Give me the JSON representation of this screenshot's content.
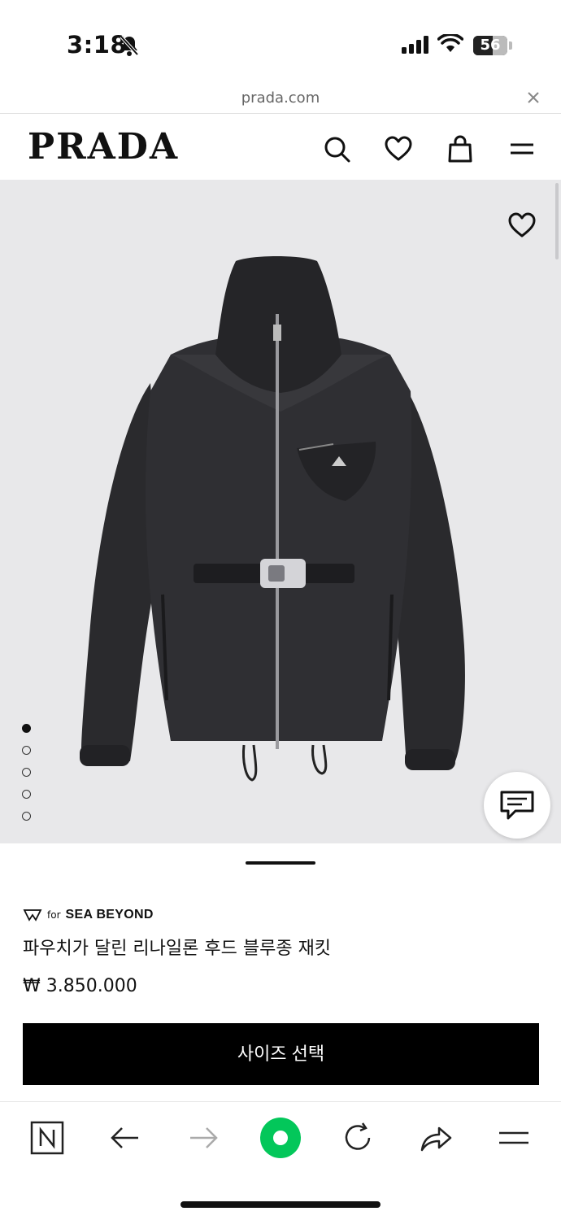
{
  "status_bar": {
    "time": "3:18",
    "battery": "56",
    "battery_level": 0.56,
    "icons": [
      "bell-slash-icon",
      "signal-icon",
      "wifi-icon",
      "battery-icon"
    ]
  },
  "browser": {
    "url": "prada.com",
    "close_icon": "close-icon"
  },
  "header": {
    "logo": "PRADA",
    "icons": [
      "search-icon",
      "heart-icon",
      "shopping-bag-icon",
      "menu-icon"
    ]
  },
  "gallery": {
    "image_alt": "black hooded nylon blouson jacket with belt and pouch",
    "slide_count": 5,
    "active_slide": 1,
    "favorite_icon": "heart-icon",
    "chat_icon": "chat-icon",
    "background": "#e8e8ea"
  },
  "product": {
    "badge_for": "for",
    "badge_brand": "SEA BEYOND",
    "title": "파우치가 달린 리나일론 후드 블루종 재킷",
    "price": "₩ 3.850.000",
    "size_button": "사이즈 선택"
  },
  "toolbar": {
    "icons": [
      "naver-icon",
      "back-arrow-icon",
      "forward-arrow-icon",
      "green-home-icon",
      "reload-icon",
      "share-icon",
      "menu-icon"
    ],
    "accent": "#03c75a"
  }
}
